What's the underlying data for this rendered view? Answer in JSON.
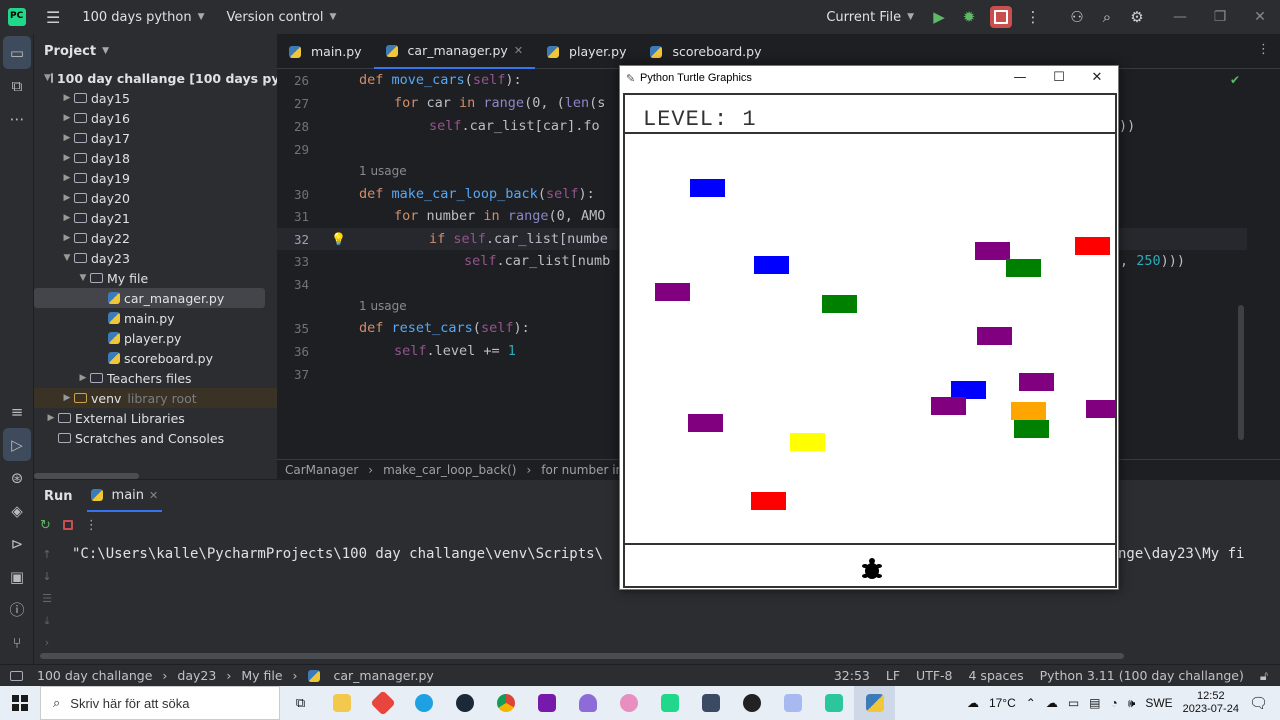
{
  "ide": {
    "project_dropdown": "100 days python",
    "vcs_dropdown": "Version control",
    "run_config": "Current File"
  },
  "project_panel": {
    "title": "Project",
    "root": "100 day challange [100 days pytho",
    "folders": [
      "day15",
      "day16",
      "day17",
      "day18",
      "day19",
      "day20",
      "day21",
      "day22",
      "day23"
    ],
    "subfolder": "My file",
    "files": [
      "car_manager.py",
      "main.py",
      "player.py",
      "scoreboard.py"
    ],
    "teachers": "Teachers files",
    "venv": "venv",
    "venv_note": "library root",
    "external": "External Libraries",
    "scratches": "Scratches and Consoles"
  },
  "tabs": [
    "main.py",
    "car_manager.py",
    "player.py",
    "scoreboard.py"
  ],
  "editor": {
    "usage_label": "1 usage",
    "line_numbers": [
      "26",
      "27",
      "28",
      "29",
      "30",
      "31",
      "32",
      "33",
      "34",
      "35",
      "36",
      "37"
    ],
    "line26": [
      "def ",
      "move_cars",
      "(",
      "self",
      "):"
    ],
    "line27": [
      "for ",
      "car ",
      "in ",
      "range",
      "(0, (",
      "len",
      "(s"
    ],
    "line28": [
      "self",
      ".car_list[car].fo"
    ],
    "line28_tail": "))",
    "line30": [
      "def ",
      "make_car_loop_back",
      "(",
      "self",
      "):"
    ],
    "line31": [
      "for ",
      "number ",
      "in ",
      "range",
      "(0, AMO"
    ],
    "line32": [
      "if ",
      "self",
      ".car_list[numbe"
    ],
    "line33": [
      "self",
      ".car_list[numb"
    ],
    "line33_tail_sep": ", ",
    "line33_tail_num": "250",
    "line33_tail_end": ")))",
    "line35": [
      "def ",
      "reset_cars",
      "(",
      "self",
      "):"
    ],
    "line36": [
      "self",
      ".level += ",
      "1"
    ]
  },
  "breadcrumb": [
    "CarManager",
    "make_car_loop_back()",
    "for number in rang"
  ],
  "run_panel": {
    "title": "Run",
    "tab": "main",
    "console_line": "\"C:\\Users\\kalle\\PycharmProjects\\100 day challange\\venv\\Scripts\\",
    "console_tail": "nge\\day23\\My fi"
  },
  "status_bar": {
    "path": [
      "100 day challange",
      "day23",
      "My file",
      "car_manager.py"
    ],
    "position": "32:53",
    "line_sep": "LF",
    "encoding": "UTF-8",
    "indent": "4 spaces",
    "interpreter": "Python 3.11 (100 day challange)"
  },
  "turtle_window": {
    "title": "Python Turtle Graphics",
    "level_text": "LEVEL: 1",
    "cars": [
      {
        "color": "#0000ff"
      },
      {
        "color": "#0000ff"
      },
      {
        "color": "#800080"
      },
      {
        "color": "#008000"
      },
      {
        "color": "#800080"
      },
      {
        "color": "#008000"
      },
      {
        "color": "#ff0000"
      },
      {
        "color": "#800080"
      },
      {
        "color": "#0000ff"
      },
      {
        "color": "#800080"
      },
      {
        "color": "#800080"
      },
      {
        "color": "#800080"
      },
      {
        "color": "#ffa500"
      },
      {
        "color": "#008000"
      },
      {
        "color": "#800080"
      },
      {
        "color": "#ffff00"
      },
      {
        "color": "#ff0000"
      }
    ]
  },
  "taskbar": {
    "search_placeholder": "Skriv här för att söka",
    "weather": "17°C",
    "language": "SWE",
    "time": "12:52",
    "date": "2023-07-24"
  }
}
